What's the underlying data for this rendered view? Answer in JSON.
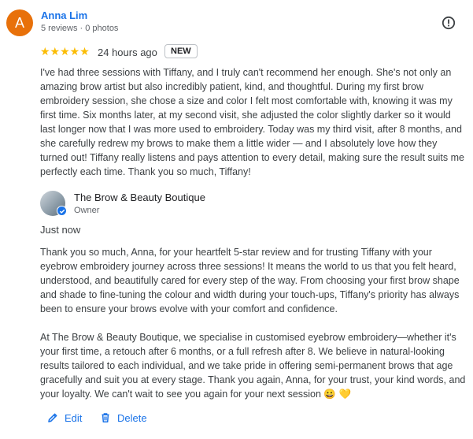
{
  "review": {
    "avatar_letter": "A",
    "reviewer_name": "Anna Lim",
    "reviewer_meta": "5 reviews · 0 photos",
    "stars_display": "★★★★★",
    "rating": 5,
    "time": "24 hours ago",
    "badge": "NEW",
    "text": "I've had three sessions with Tiffany, and I truly can't recommend her enough. She's not only an amazing brow artist but also incredibly patient, kind, and thoughtful. During my first brow embroidery session, she chose a size and color I felt most comfortable with, knowing it was my first time. Six months later, at my second visit, she adjusted the color slightly darker so it would last longer now that I was more used to embroidery. Today was my third visit, after 8 months, and she carefully redrew my brows to make them a little wider — and I absolutely love how they turned out! Tiffany really listens and pays attention to every detail, making sure the result suits me perfectly each time. Thank you so much, Tiffany!"
  },
  "owner_reply": {
    "business_name": "The Brow & Beauty Boutique",
    "role": "Owner",
    "time": "Just now",
    "paragraph_1": "Thank you so much, Anna, for your heartfelt 5-star review and for trusting Tiffany with your eyebrow embroidery journey across three sessions! It means the world to us that you felt heard, understood, and beautifully cared for every step of the way. From choosing your first brow shape and shade to fine-tuning the colour and width during your touch-ups, Tiffany's priority has always been to ensure your brows evolve with your comfort and confidence.",
    "paragraph_2": "At The Brow & Beauty Boutique, we specialise in customised eyebrow embroidery—whether it's your first time, a retouch after 6 months, or a full refresh after 8. We believe in natural-looking results tailored to each individual, and we take pride in offering semi-permanent brows that age gracefully and suit you at every stage. Thank you again, Anna, for your trust, your kind words, and your loyalty. We can't wait to see you again for your next session 😀 💛"
  },
  "actions": {
    "edit_label": "Edit",
    "delete_label": "Delete"
  },
  "colors": {
    "avatar": "#e8710a",
    "link": "#1a73e8",
    "star": "#fbbc04"
  }
}
